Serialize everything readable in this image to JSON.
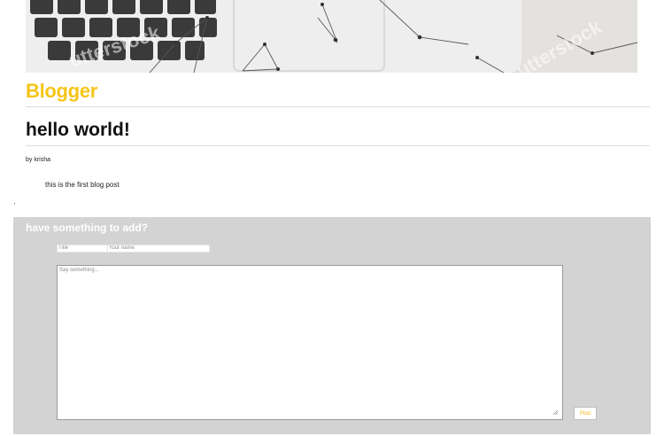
{
  "banner": {
    "watermark_left": "utterstock",
    "watermark_right": "utterstock"
  },
  "site": {
    "brand": "Blogger",
    "brand_color": "#f5c518"
  },
  "post": {
    "title": "hello world!",
    "byline": "by krisha",
    "body": "this is the first blog post"
  },
  "comments": {
    "heading": "have something to add?",
    "title_placeholder": "Title",
    "name_placeholder": "Your name",
    "message_placeholder": "Say something...",
    "submit_label": "Post",
    "panel_color": "#d3d3d3",
    "submit_color": "#f0b400"
  }
}
